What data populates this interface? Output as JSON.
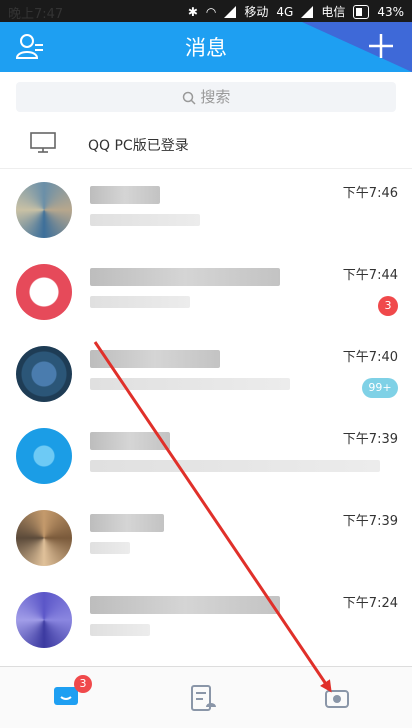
{
  "status_bar": {
    "time": "晚上7:47",
    "net": "4G",
    "carrier1": "移动",
    "carrier2": "电信",
    "battery": "43%"
  },
  "header": {
    "title": "消息"
  },
  "search": {
    "placeholder": "搜索"
  },
  "pc_login": {
    "text": "QQ PC版已登录"
  },
  "chats": [
    {
      "time": "下午7:46",
      "badge": ""
    },
    {
      "time": "下午7:44",
      "badge": "3"
    },
    {
      "time": "下午7:40",
      "badge": "99+"
    },
    {
      "time": "下午7:39",
      "badge": ""
    },
    {
      "time": "下午7:39",
      "badge": ""
    },
    {
      "time": "下午7:24",
      "badge": ""
    }
  ],
  "tabbar": {
    "messages_badge": "3"
  },
  "colors": {
    "header": "#1e9ff2",
    "accent_tri": "#3e69d8",
    "badge_red": "#f0494b",
    "badge_soft": "#7fd1e6",
    "arrow": "#e0302a"
  }
}
